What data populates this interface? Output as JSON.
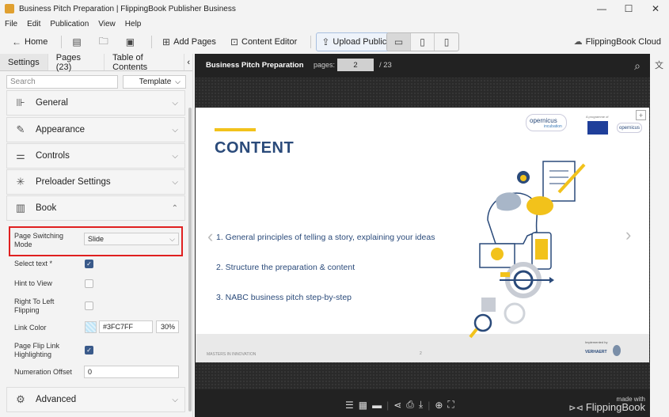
{
  "window": {
    "title": "Business Pitch Preparation | FlippingBook Publisher Business",
    "min": "—",
    "max": "☐",
    "close": "✕"
  },
  "menu": [
    "File",
    "Edit",
    "Publication",
    "View",
    "Help"
  ],
  "toolbar": {
    "home": "Home",
    "add_pages": "Add Pages",
    "content_editor": "Content Editor",
    "upload": "Upload Publication",
    "cloud": "FlippingBook Cloud"
  },
  "sidebar": {
    "tabs": [
      "Settings",
      "Pages (23)",
      "Table of Contents"
    ],
    "search_placeholder": "Search",
    "template": "Template",
    "sections": [
      "General",
      "Appearance",
      "Controls",
      "Preloader Settings",
      "Book",
      "Advanced"
    ],
    "book": {
      "page_switching_label": "Page Switching Mode",
      "page_switching_value": "Slide",
      "select_text": "Select text *",
      "select_text_checked": true,
      "hint_to_view": "Hint to View",
      "hint_to_view_checked": false,
      "rtl": "Right To Left Flipping",
      "rtl_checked": false,
      "link_color": "Link Color",
      "link_color_value": "#3FC7FF",
      "link_opacity": "30%",
      "flip_link": "Page Flip Link Highlighting",
      "flip_link_checked": true,
      "numeration_offset": "Numeration Offset",
      "numeration_value": "0"
    }
  },
  "viewer": {
    "title": "Business Pitch Preparation",
    "pages_label": "pages:",
    "current_page": "2",
    "total": "/ 23",
    "slide": {
      "heading": "CONTENT",
      "items": [
        "1.  General principles of telling a story, explaining your ideas",
        "2. Structure  the preparation & content",
        "3. NABC business pitch step-by-step"
      ],
      "logo1": "opernicus",
      "logo1_sub": "incubation",
      "programme": "A programme of",
      "logo2": "opernicus",
      "footer_left": "MASTERS IN INNOVATION",
      "footer_page": "2",
      "implemented_by": "Implemented by",
      "verhaert": "VERHAERT"
    },
    "made_with": "made with",
    "brand": "FlippingBook"
  }
}
